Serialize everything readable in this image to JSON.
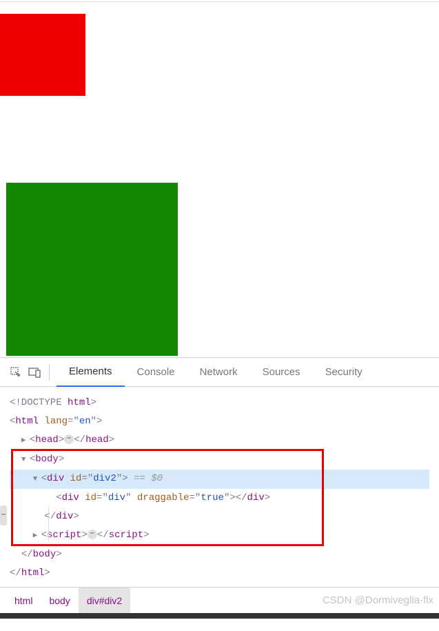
{
  "colors": {
    "red": "#ee0000",
    "green": "#118800"
  },
  "tabs": {
    "elements": "Elements",
    "console": "Console",
    "network": "Network",
    "sources": "Sources",
    "security": "Security"
  },
  "dom": {
    "doctype": "<!DOCTYPE html>",
    "html_open": "<html lang=\"en\">",
    "head_open": "<head>",
    "ellipsis": "…",
    "head_close": "</head>",
    "body_open": "<body>",
    "div2_open": "<div id=\"div2\">",
    "eq_dollar": " == $0",
    "div_inner": "<div id=\"div\" draggable=\"true\"></div>",
    "div2_close": "</div>",
    "script_open": "<script>",
    "script_close": "</script>",
    "body_close": "</body>",
    "html_close": "</html>"
  },
  "breadcrumb": {
    "html": "html",
    "body": "body",
    "div2": "div#div2"
  },
  "watermark": "CSDN @Dormiveglia-flx"
}
